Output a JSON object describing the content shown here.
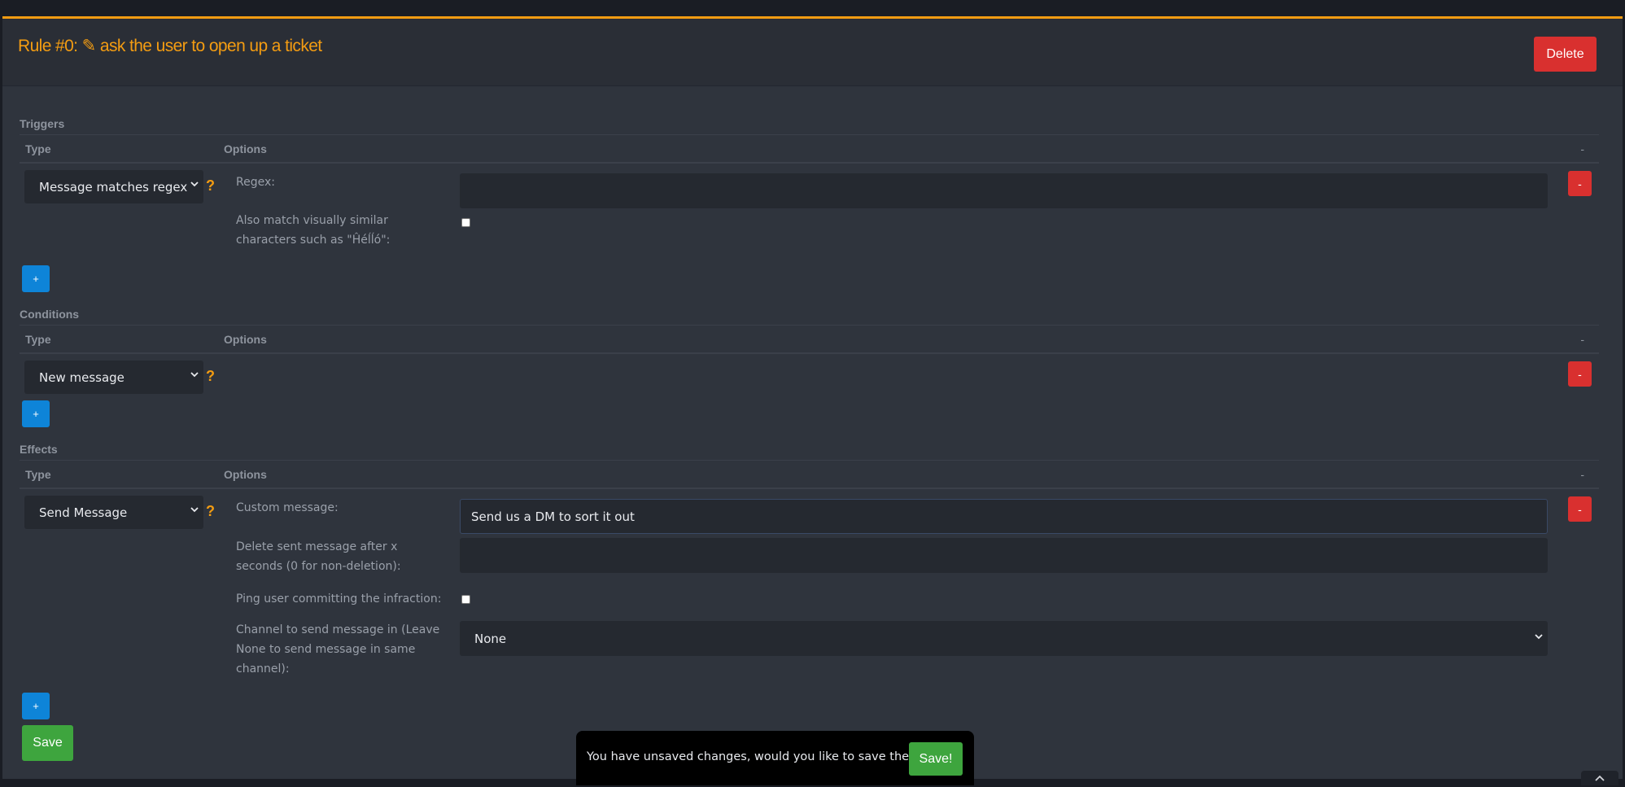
{
  "rule": {
    "title": "Rule #0: ✎ ask the user to open up a ticket",
    "delete_label": "Delete"
  },
  "table_headers": {
    "type": "Type",
    "options": "Options",
    "remove": "-"
  },
  "triggers": {
    "section_label": "Triggers",
    "type_selected": "Message matches regex",
    "help": "?",
    "options": {
      "regex_label": "Regex:",
      "regex_value": "",
      "similar_chars_label": "Also match visually similar characters such as \"Ĥéĺĺó\":",
      "similar_chars_checked": false
    },
    "remove_label": "-",
    "add_label": "+"
  },
  "conditions": {
    "section_label": "Conditions",
    "type_selected": "New message",
    "help": "?",
    "remove_label": "-",
    "add_label": "+"
  },
  "effects": {
    "section_label": "Effects",
    "type_selected": "Send Message",
    "help": "?",
    "options": {
      "custom_message_label": "Custom message:",
      "custom_message_value": "Send us a DM to sort it out",
      "delete_after_label": "Delete sent message after x seconds (0 for non-deletion):",
      "delete_after_value": "",
      "ping_user_label": "Ping user committing the infraction:",
      "ping_user_checked": false,
      "channel_label": "Channel to send message in (Leave None to send message in same channel):",
      "channel_selected": "None"
    },
    "remove_label": "-",
    "add_label": "+"
  },
  "save_label": "Save",
  "toast": {
    "message": "You have unsaved changes, would you like to save them?",
    "save_label": "Save!"
  },
  "colors": {
    "accent": "#f39c12",
    "danger": "#d9302f",
    "primary": "#0e84d8",
    "success": "#3ea53e"
  }
}
